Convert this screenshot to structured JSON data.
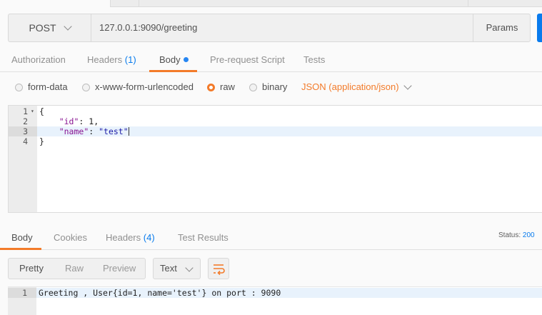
{
  "request": {
    "method": "POST",
    "url": "127.0.0.1:9090/greeting",
    "params_label": "Params"
  },
  "request_tabs": [
    {
      "label": "Authorization"
    },
    {
      "label": "Headers",
      "count": "(1)"
    },
    {
      "label": "Body"
    },
    {
      "label": "Pre-request Script"
    },
    {
      "label": "Tests"
    }
  ],
  "body_types": {
    "form_data": "form-data",
    "urlencoded": "x-www-form-urlencoded",
    "raw": "raw",
    "binary": "binary",
    "content_type": "JSON (application/json)"
  },
  "editor": {
    "lines": [
      {
        "n": "1",
        "text": "{"
      },
      {
        "n": "2",
        "key": "\"id\"",
        "value": "1,"
      },
      {
        "n": "3",
        "key": "\"name\"",
        "value": "\"test\""
      },
      {
        "n": "4",
        "text": "}"
      }
    ]
  },
  "response_tabs": [
    {
      "label": "Body"
    },
    {
      "label": "Cookies"
    },
    {
      "label": "Headers",
      "count": "(4)"
    },
    {
      "label": "Test Results"
    }
  ],
  "status": {
    "label": "Status:",
    "value": "200"
  },
  "view_modes": {
    "pretty": "Pretty",
    "raw": "Raw",
    "preview": "Preview"
  },
  "format_select": "Text",
  "response": {
    "line_number": "1",
    "text": "Greeting , User{id=1, name='test'} on port : 9090"
  },
  "colors": {
    "accent": "#f37b2a",
    "link": "#097bed"
  }
}
